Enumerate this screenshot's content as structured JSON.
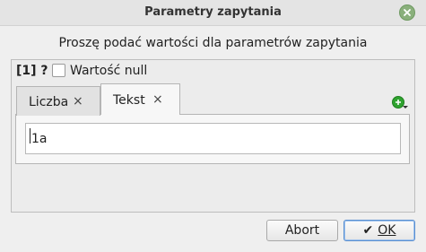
{
  "window": {
    "title": "Parametry zapytania",
    "close_icon": "close-icon"
  },
  "prompt": "Proszę podać wartości dla parametrów zapytania",
  "parameter": {
    "label": "[1] ?",
    "null_checkbox_label": "Wartość null",
    "null_checked": false
  },
  "tabs": [
    {
      "label": "Liczba",
      "close_glyph": "×",
      "active": false
    },
    {
      "label": "Tekst",
      "close_glyph": "×",
      "active": true
    }
  ],
  "add_icon": "add-icon",
  "input": {
    "value": "1a"
  },
  "buttons": {
    "abort_label": "Abort",
    "ok_label": "OK",
    "ok_icon": "check-icon"
  }
}
